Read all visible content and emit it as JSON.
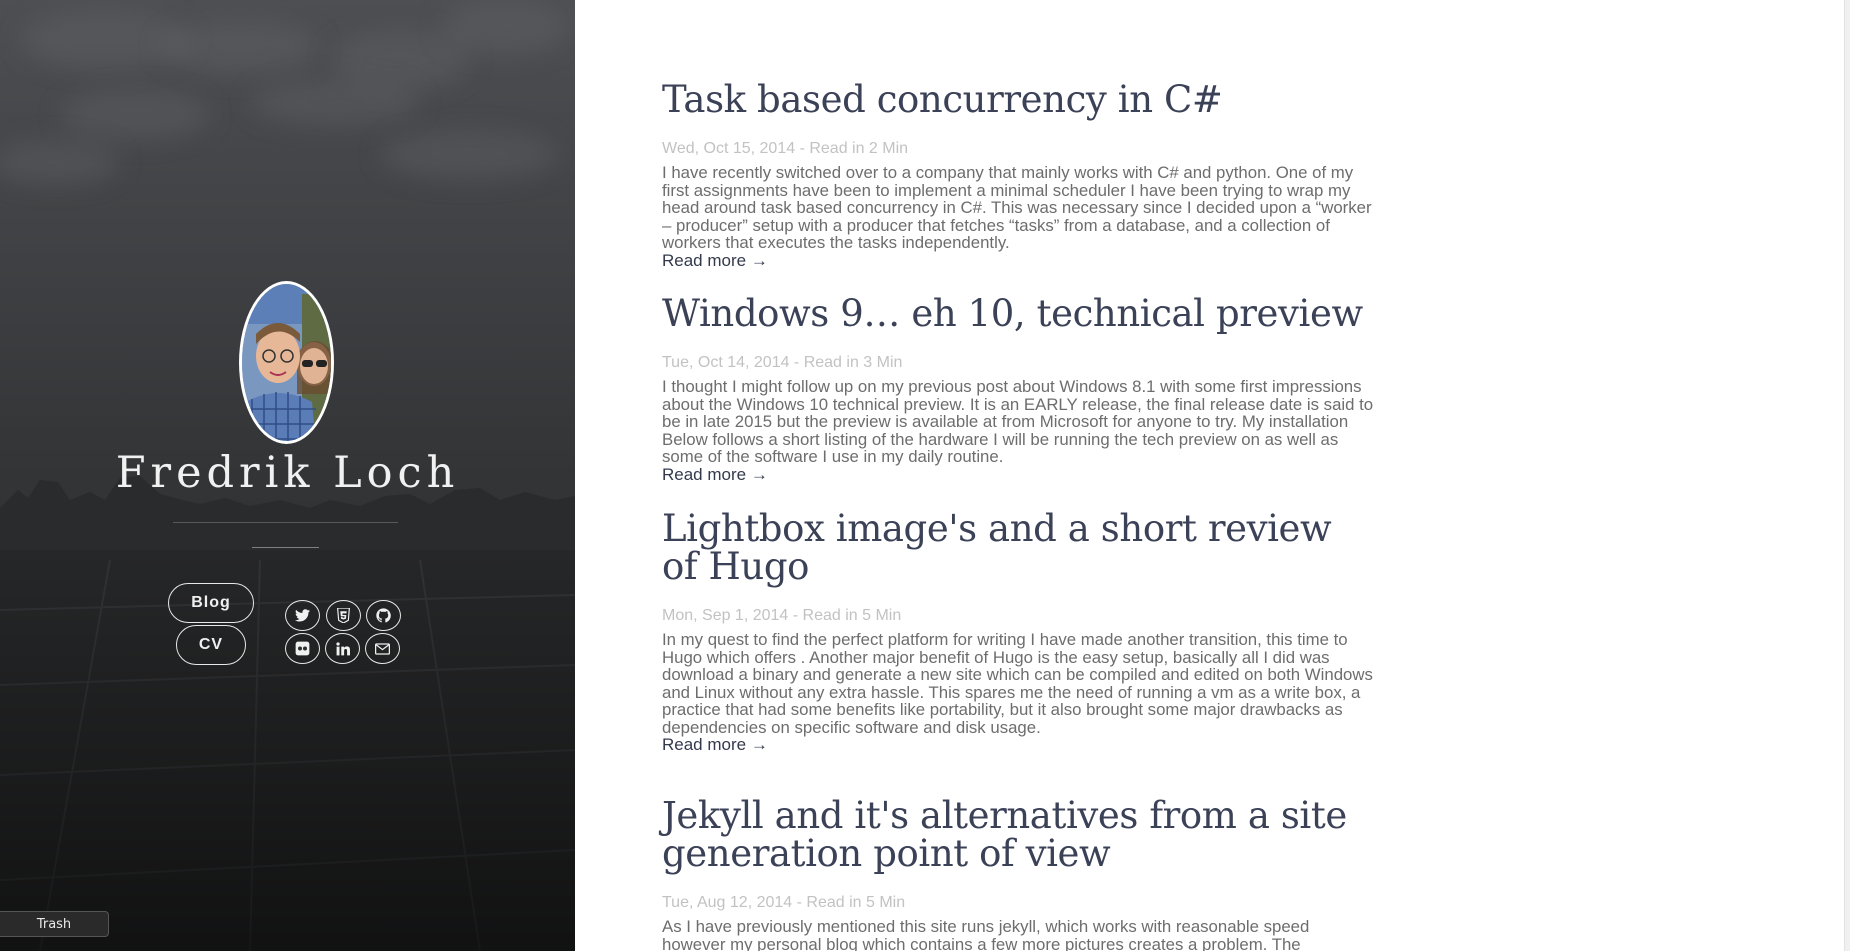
{
  "profile": {
    "name": "Fredrik Loch",
    "avatar_alt": ""
  },
  "nav": {
    "items": [
      {
        "label": "Blog"
      },
      {
        "label": "CV"
      }
    ]
  },
  "social": {
    "icons": [
      "twitter-icon",
      "html5-icon",
      "github-icon",
      "flickr-icon",
      "linkedin-icon",
      "email-icon"
    ]
  },
  "taskbar": {
    "trash_label": "Trash"
  },
  "posts": [
    {
      "title": "Task based concurrency in C#",
      "meta": "Wed, Oct 15, 2014 - Read in 2 Min",
      "excerpt": "I have recently switched over to a company that mainly works with C# and python. One of my first assignments have been to implement a minimal scheduler I have been trying to wrap my head around task based concurrency in C#. This was necessary since I decided upon a “worker – producer” setup with a producer that fetches “tasks” from a database, and a collection of workers that executes the tasks independently.",
      "read_more": "Read more →"
    },
    {
      "title": "Windows 9… eh 10, technical preview",
      "meta": "Tue, Oct 14, 2014 - Read in 3 Min",
      "excerpt": "I thought I might follow up on my previous post about Windows 8.1 with some first impressions about the Windows 10 technical preview. It is an EARLY release, the final release date is said to be in late 2015 but the preview is available at from Microsoft for anyone to try. My installation Below follows a short listing of the hardware I will be running the tech preview on as well as some of the software I use in my daily routine.",
      "read_more": "Read more →"
    },
    {
      "title": "Lightbox image's and a short review of Hugo",
      "meta": "Mon, Sep 1, 2014 - Read in 5 Min",
      "excerpt": "In my quest to find the perfect platform for writing I have made another transition, this time to Hugo which offers . Another major benefit of Hugo is the easy setup, basically all I did was download a binary and generate a new site which can be compiled and edited on both Windows and Linux without any extra hassle. This spares me the need of running a vm as a write box, a practice that had some benefits like portability, but it also brought some major drawbacks as dependencies on specific software and disk usage.",
      "read_more": "Read more →"
    },
    {
      "title": "Jekyll and it's alternatives from a site generation point of view",
      "meta": "Tue, Aug 12, 2014 - Read in 5 Min",
      "excerpt": "As I have previously mentioned this site runs jekyll, which works with reasonable speed however my personal blog which contains a few more pictures creates a problem. The",
      "read_more": ""
    }
  ]
}
